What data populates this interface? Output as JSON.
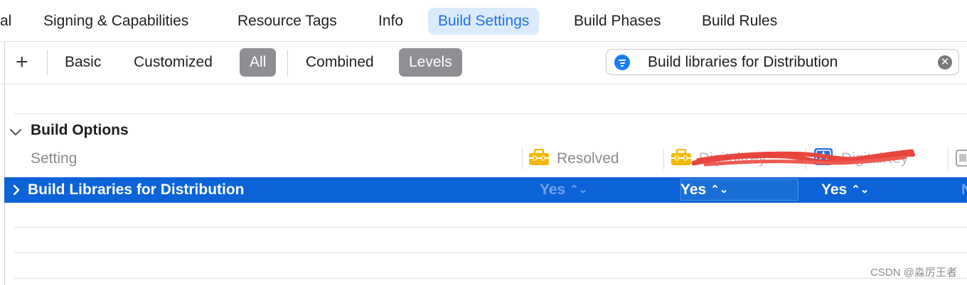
{
  "tabs": [
    {
      "label": "al",
      "active": false
    },
    {
      "label": "Signing & Capabilities",
      "active": false
    },
    {
      "label": "Resource Tags",
      "active": false
    },
    {
      "label": "Info",
      "active": false
    },
    {
      "label": "Build Settings",
      "active": true
    },
    {
      "label": "Build Phases",
      "active": false
    },
    {
      "label": "Build Rules",
      "active": false
    }
  ],
  "toolbar": {
    "add_label": "+",
    "filters": [
      "Basic",
      "Customized",
      "All",
      "Combined",
      "Levels"
    ],
    "selected": [
      "All",
      "Levels"
    ]
  },
  "search": {
    "value": "Build libraries for Distribution",
    "filter_icon": "filter-icon",
    "clear_icon": "clear-icon"
  },
  "section": {
    "title": "Build Options",
    "expanded": true
  },
  "columns": {
    "setting": "Setting",
    "resolved": "Resolved",
    "target": "DigitalKey",
    "project": "DigitalKey"
  },
  "row": {
    "title": "Build Libraries for Distribution",
    "resolved_value": "Yes",
    "target_value": "Yes",
    "project_value": "Yes",
    "overflow_value": "N",
    "stepper_glyph": "⌃⌄"
  },
  "colors": {
    "accent": "#1b73e8",
    "row_selected": "#0c63d8",
    "segment_selected": "#8e8e93",
    "redaction": "#e8453c",
    "toolbox": "#f5b800"
  },
  "watermark": "CSDN @淼厉王者"
}
